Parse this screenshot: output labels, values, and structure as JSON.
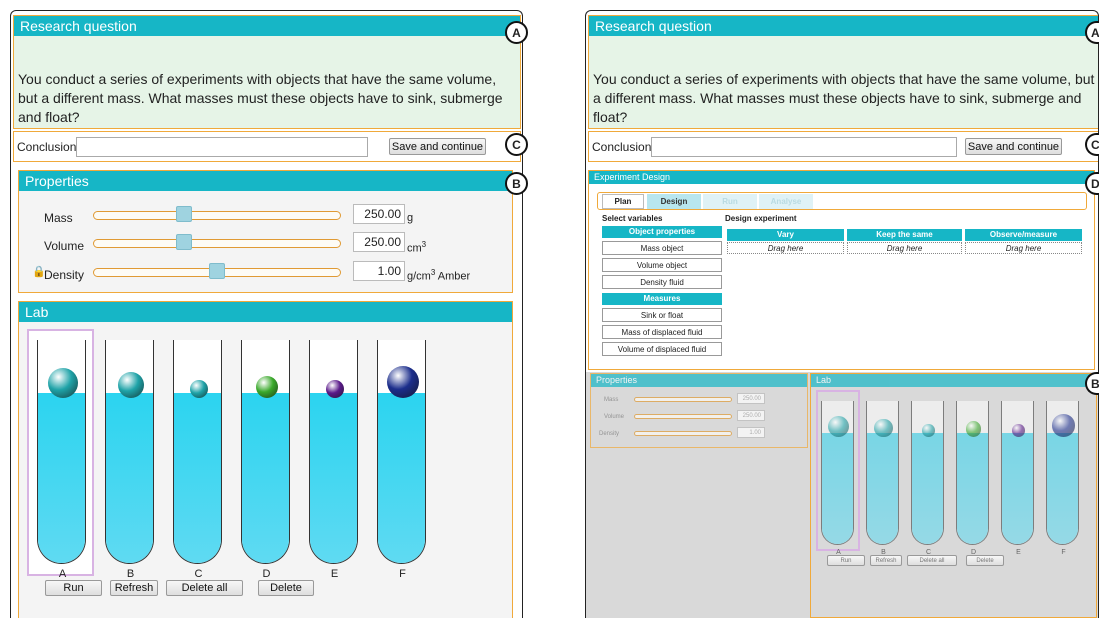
{
  "research_question": {
    "title": "Research question",
    "text": "You conduct a series of experiments with objects that have the same volume, but a different mass. What masses must these objects have to sink, submerge and float?"
  },
  "conclusion": {
    "label": "Conclusion:",
    "value": "",
    "save_label": "Save and continue"
  },
  "properties": {
    "title": "Properties",
    "mass": {
      "label": "Mass",
      "value": "250.00",
      "unit": "g",
      "level": 0.37
    },
    "volume": {
      "label": "Volume",
      "value": "250.00",
      "unit": "cm",
      "unit_sup": "3",
      "level": 0.37
    },
    "density": {
      "label": "Density",
      "value": "1.00",
      "unit": "g/cm",
      "unit_sup": "3",
      "suffix": "Amber",
      "level": 0.5
    }
  },
  "lab": {
    "title": "Lab",
    "tubes": [
      {
        "label": "A",
        "color": "#1fa3a8",
        "selected": true
      },
      {
        "label": "B",
        "color": "#1fa3a8"
      },
      {
        "label": "C",
        "color": "#1fa3a8"
      },
      {
        "label": "D",
        "color": "#3aa92b"
      },
      {
        "label": "E",
        "color": "#5a1a8a"
      },
      {
        "label": "F",
        "color": "#1c2e8c"
      }
    ],
    "buttons": {
      "run": "Run",
      "refresh": "Refresh",
      "delete_all": "Delete all",
      "delete": "Delete"
    }
  },
  "badges": {
    "a": "A",
    "b": "B",
    "c": "C",
    "d": "D"
  },
  "experiment": {
    "title": "Experiment Design",
    "tabs": [
      "Plan",
      "Design",
      "Run",
      "Analyse"
    ],
    "select_variables": "Select variables",
    "design_experiment": "Design experiment",
    "object_properties": "Object properties",
    "vars": [
      "Mass object",
      "Volume object",
      "Density fluid"
    ],
    "measures": "Measures",
    "measure_items": [
      "Sink or float",
      "Mass of displaced fluid",
      "Volume of displaced fluid"
    ],
    "columns": [
      "Vary",
      "Keep the same",
      "Observe/measure"
    ],
    "drag": "Drag here"
  }
}
